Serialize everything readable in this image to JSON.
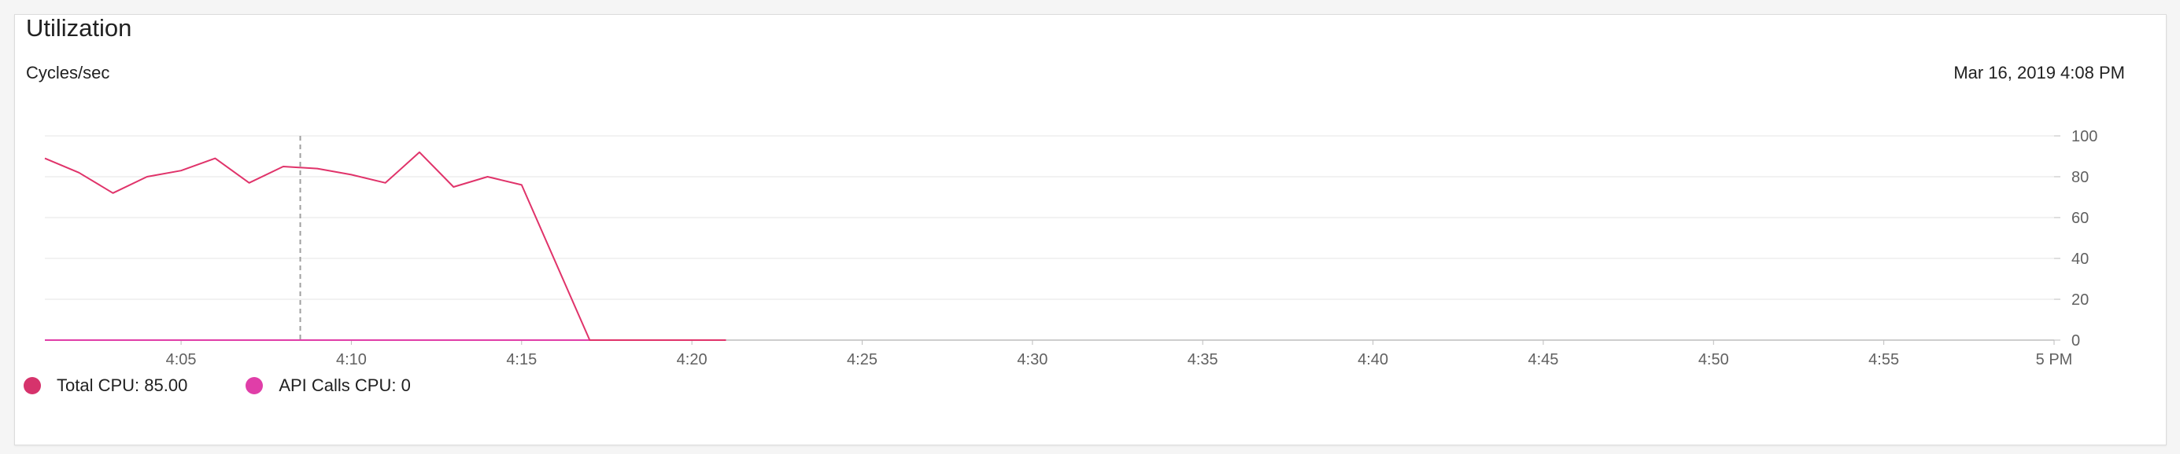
{
  "panel": {
    "title": "Utilization",
    "subtitle": "Cycles/sec",
    "timestamp": "Mar 16, 2019 4:08 PM"
  },
  "legend": [
    {
      "label": "Total CPU: 85.00",
      "color": "#d6336c"
    },
    {
      "label": "API Calls CPU: 0",
      "color": "#e03ea8"
    }
  ],
  "chart_data": {
    "type": "line",
    "title": "Utilization",
    "ylabel": "Cycles/sec",
    "ylim": [
      0,
      100
    ],
    "yticks": [
      0,
      20,
      40,
      60,
      80,
      100
    ],
    "y_axis_side": "right",
    "xlim": [
      "4:01",
      "5:00"
    ],
    "xticks": [
      "4:05",
      "4:10",
      "4:15",
      "4:20",
      "4:25",
      "4:30",
      "4:35",
      "4:40",
      "4:45",
      "4:50",
      "4:55",
      "5 PM"
    ],
    "grid": true,
    "legend_position": "bottom-left",
    "cursor_x": "4:08",
    "series": [
      {
        "name": "Total CPU",
        "color": "#e0336a",
        "x": [
          "4:01",
          "4:02",
          "4:03",
          "4:04",
          "4:05",
          "4:06",
          "4:07",
          "4:08",
          "4:09",
          "4:10",
          "4:11",
          "4:12",
          "4:13",
          "4:14",
          "4:15",
          "4:17",
          "4:21"
        ],
        "values": [
          89,
          82,
          72,
          80,
          83,
          89,
          77,
          85,
          84,
          81,
          77,
          92,
          75,
          80,
          76,
          0,
          0
        ]
      },
      {
        "name": "API Calls CPU",
        "color": "#e03ea8",
        "x": [
          "4:01",
          "4:21"
        ],
        "values": [
          0,
          0
        ]
      }
    ]
  }
}
